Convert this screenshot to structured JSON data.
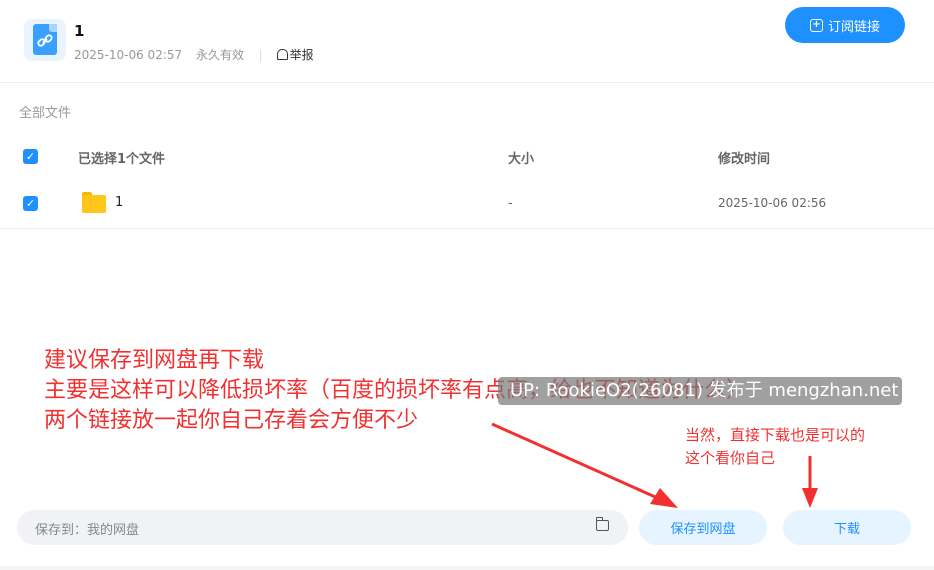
{
  "header": {
    "title": "1",
    "date": "2025-10-06 02:57",
    "validity": "永久有效",
    "report_label": "举报",
    "subscribe_label": "订阅链接"
  },
  "breadcrumb": "全部文件",
  "table": {
    "columns": [
      "已选择1个文件",
      "大小",
      "修改时间"
    ],
    "rows": [
      {
        "name": "1",
        "size": "-",
        "modified": "2025-10-06 02:56",
        "checked": true
      }
    ]
  },
  "annotations": {
    "main_lines": [
      "建议保存到网盘再下载",
      "主要是这样可以降低损坏率（百度的损坏率有点高，给也不知道为什么）",
      "两个链接放一起你自己存着会方便不少"
    ],
    "side_lines": [
      "当然，直接下载也是可以的",
      "这个看你自己"
    ],
    "color": "#f23030"
  },
  "watermark": "UP: RookieO2(26081) 发布于 mengzhan.net",
  "footer": {
    "save_path_label": "保存到：我的网盘",
    "save_button": "保存到网盘",
    "download_button": "下载"
  },
  "colors": {
    "accent": "#1e90ff",
    "light_button": "#e6f4ff"
  }
}
